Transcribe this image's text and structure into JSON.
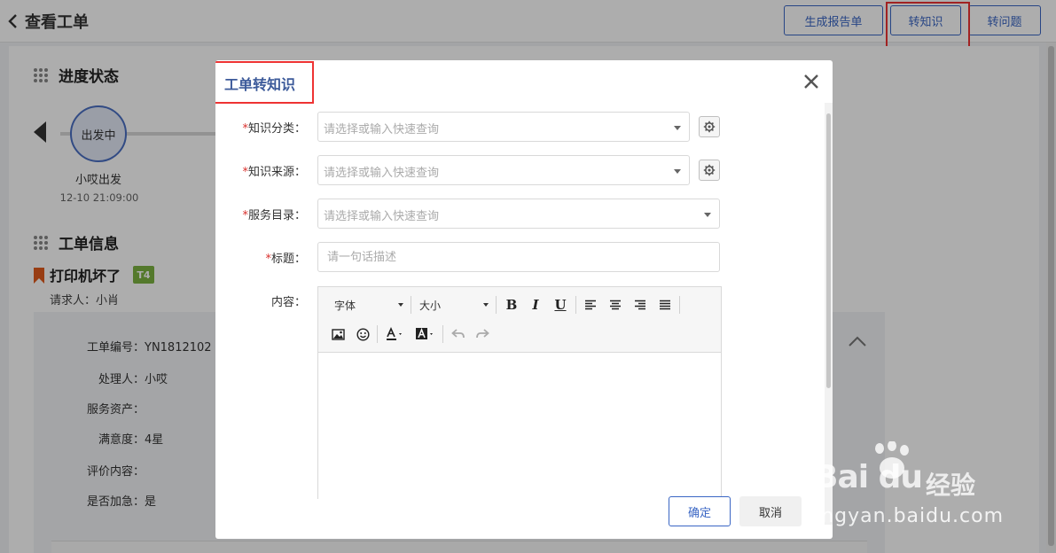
{
  "header": {
    "back_title": "查看工单",
    "buttons": {
      "report": "生成报告单",
      "to_knowledge": "转知识",
      "to_problem": "转问题"
    }
  },
  "progress": {
    "title": "进度状态",
    "node_status": "出发中",
    "node_name": "小哎出发",
    "node_time": "12-10 21:09:00"
  },
  "ticket": {
    "section_title": "工单信息",
    "title": "打印机坏了",
    "tag": "T4",
    "requester": "请求人：小肖",
    "fields": {
      "number": "工单编号：YN1812102",
      "handler": "处理人：小哎",
      "asset": "服务资产：",
      "satisfaction": "满意度：4星",
      "comment": "评价内容：",
      "urgent": "是否加急：是"
    }
  },
  "modal": {
    "title": "工单转知识",
    "fields": {
      "category": {
        "required": "*",
        "label": "知识分类：",
        "placeholder": "请选择或输入快速查询"
      },
      "source": {
        "required": "*",
        "label": "知识来源：",
        "placeholder": "请选择或输入快速查询"
      },
      "catalog": {
        "required": "*",
        "label": "服务目录：",
        "placeholder": "请选择或输入快速查询"
      },
      "title": {
        "required": "*",
        "label": "标题：",
        "placeholder": "请一句话描述"
      },
      "content": {
        "label": "内容："
      }
    },
    "editor": {
      "font": "字体",
      "size": "大小",
      "bold": "B",
      "italic": "I",
      "underline": "U"
    },
    "buttons": {
      "ok": "确定",
      "cancel": "取消"
    }
  },
  "watermark": {
    "logo": "Bai du",
    "cn": "经验",
    "url": "jingyan.baidu.com"
  }
}
